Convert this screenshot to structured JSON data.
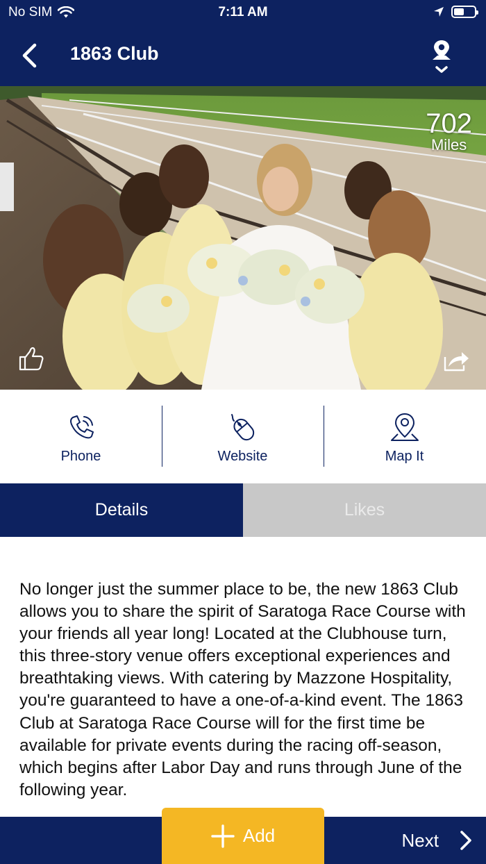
{
  "status_bar": {
    "carrier": "No SIM",
    "time": "7:11 AM"
  },
  "nav": {
    "title": "1863 Club",
    "back_icon": "chevron-left-icon",
    "location_icon": "location-pin-dropdown-icon"
  },
  "hero": {
    "distance_value": "702",
    "distance_unit": "Miles",
    "like_icon": "thumbs-up-icon",
    "share_icon": "share-icon"
  },
  "actions": [
    {
      "label": "Phone",
      "icon": "phone-icon"
    },
    {
      "label": "Website",
      "icon": "mouse-icon"
    },
    {
      "label": "Map It",
      "icon": "map-pin-icon"
    }
  ],
  "tabs": {
    "details": "Details",
    "likes": "Likes",
    "active": "Details"
  },
  "description": "No longer just the summer place to be, the new 1863 Club allows you to share the spirit of Saratoga Race Course with your friends all year long! Located at the Clubhouse turn, this three-story venue offers exceptional experiences and breathtaking views. With catering by Mazzone Hospitality, you're guaranteed to have a one-of-a-kind event. The 1863 Club at Saratoga Race Course will for the first time be available for private events during the racing off-season, which begins after Labor Day and runs through June of the following year.",
  "bottom": {
    "add_label": "Add",
    "next_label": "Next"
  },
  "colors": {
    "navy": "#0d2260",
    "accent": "#f4b724",
    "tab_inactive": "#c8c8c8"
  }
}
